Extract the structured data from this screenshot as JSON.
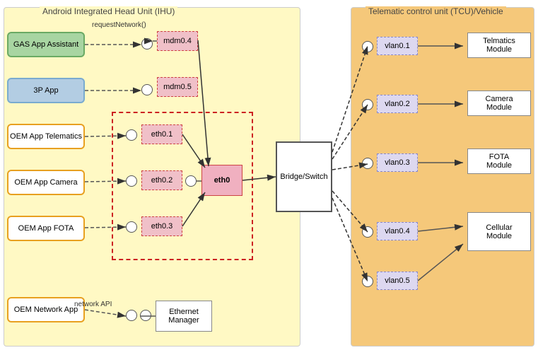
{
  "diagram": {
    "title_ihu": "Android Integrated Head Unit (IHU)",
    "title_tcu": "Telematic control unit (TCU)/Vehicle",
    "apps": [
      {
        "id": "gas",
        "label": "GAS App Assistant"
      },
      {
        "id": "3p",
        "label": "3P App"
      },
      {
        "id": "oem-telematics",
        "label": "OEM App Telematics"
      },
      {
        "id": "oem-camera",
        "label": "OEM App Camera"
      },
      {
        "id": "oem-fota",
        "label": "OEM App FOTA"
      },
      {
        "id": "oem-network",
        "label": "OEM Network App"
      }
    ],
    "net_interfaces": [
      {
        "id": "mdm04",
        "label": "mdm0.4"
      },
      {
        "id": "mdm05",
        "label": "mdm0.5"
      },
      {
        "id": "eth01",
        "label": "eth0.1"
      },
      {
        "id": "eth02",
        "label": "eth0.2"
      },
      {
        "id": "eth03",
        "label": "eth0.3"
      },
      {
        "id": "eth0",
        "label": "eth0"
      }
    ],
    "bridge": "Bridge/Switch",
    "eth_manager": "Ethernet\nManager",
    "tcu_modules": [
      {
        "id": "telmatics",
        "label": "Telmatics\nModule"
      },
      {
        "id": "camera",
        "label": "Camera\nModule"
      },
      {
        "id": "fota",
        "label": "FOTA\nModule"
      },
      {
        "id": "cellular",
        "label": "Cellular\nModule"
      }
    ],
    "vlans": [
      {
        "id": "vlan01",
        "label": "vlan0.1"
      },
      {
        "id": "vlan02",
        "label": "vlan0.2"
      },
      {
        "id": "vlan03",
        "label": "vlan0.3"
      },
      {
        "id": "vlan04",
        "label": "vlan0.4"
      },
      {
        "id": "vlan05",
        "label": "vlan0.5"
      }
    ],
    "labels": {
      "request_network": "requestNetwork()",
      "network_api": "network API"
    }
  }
}
